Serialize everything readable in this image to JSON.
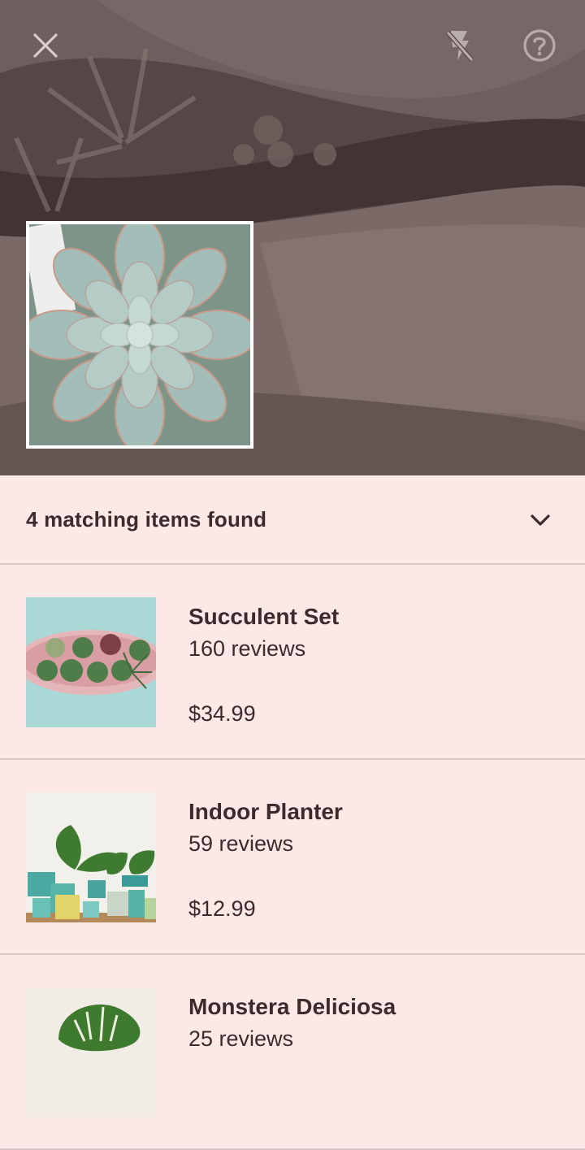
{
  "toolbar": {
    "close_icon": "close-icon",
    "flash_icon": "flash-off-icon",
    "help_icon": "help-circle-icon"
  },
  "results_header": {
    "title": "4 matching items found",
    "toggle_icon": "chevron-down-icon"
  },
  "results": [
    {
      "name": "Succulent Set",
      "reviews": "160 reviews",
      "price": "$34.99"
    },
    {
      "name": "Indoor Planter",
      "reviews": "59 reviews",
      "price": "$12.99"
    },
    {
      "name": "Monstera Deliciosa",
      "reviews": "25 reviews",
      "price": ""
    }
  ],
  "colors": {
    "sheet_background": "#fde8e8",
    "text": "#3e2a2b",
    "divider": "#d8c7c7",
    "camera_overlay": "#5b4c4b"
  }
}
